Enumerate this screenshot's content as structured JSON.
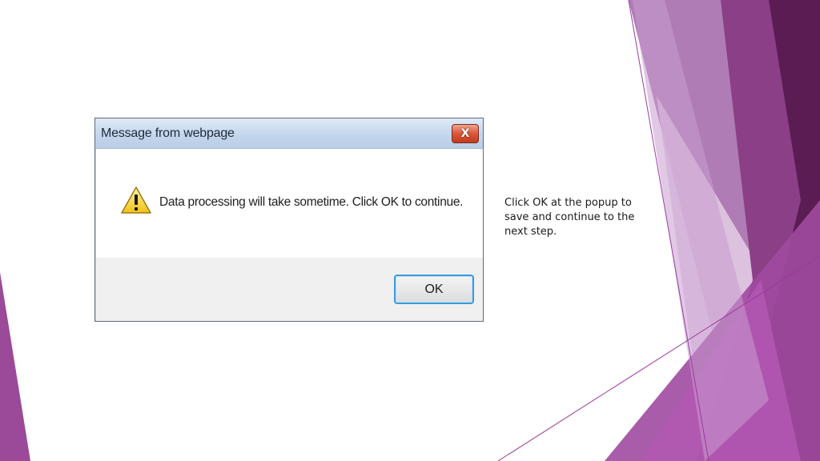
{
  "dialog": {
    "title": "Message from webpage",
    "message": "Data processing will take sometime. Click OK to continue.",
    "close_label": "X",
    "ok_label": "OK",
    "icon": "warning-icon"
  },
  "caption": "Click OK at the popup to save and continue to the next step.",
  "theme": {
    "accent_purple": "#9b3a9e",
    "dark_purple": "#5a1c52",
    "light_purple": "#c28fc7",
    "titlebar_blue": "#c4d6ec",
    "ok_border_blue": "#3c9ad8",
    "close_red": "#d9573a"
  }
}
